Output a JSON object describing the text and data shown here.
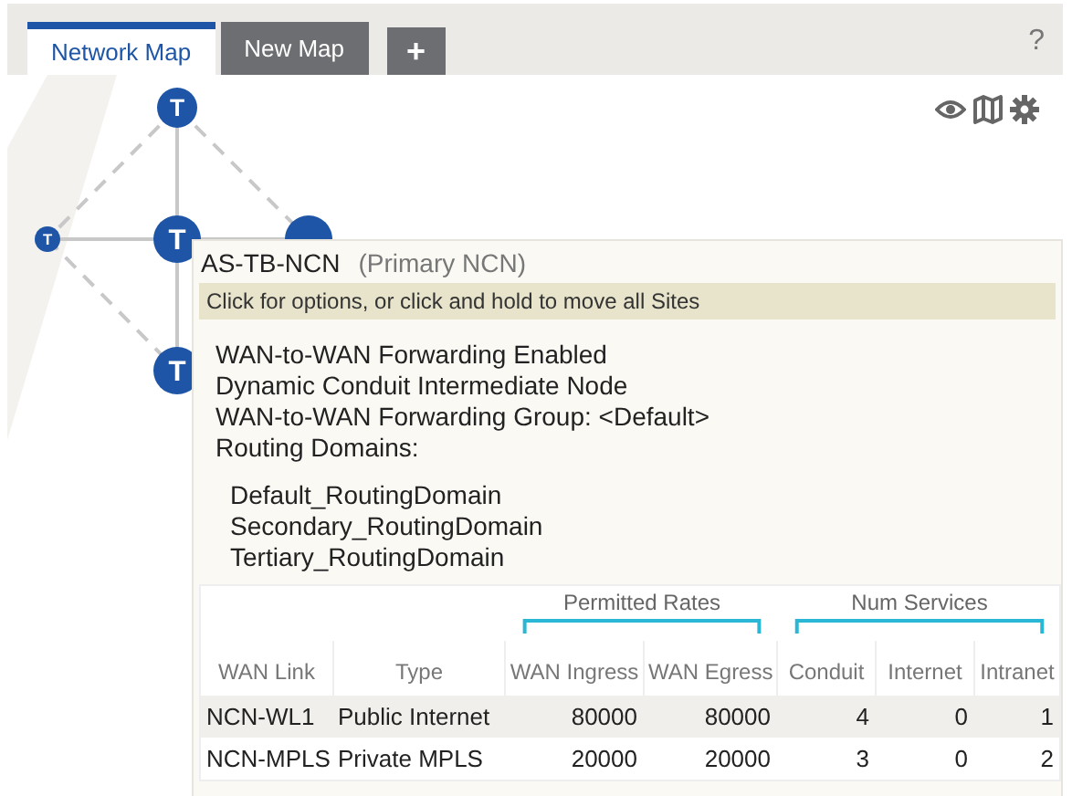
{
  "tabs": [
    {
      "label": "Network Map",
      "selected": true
    },
    {
      "label": "New Map",
      "selected": false
    }
  ],
  "add_tab": "+",
  "help": "?",
  "toolbar": [
    {
      "kind": "eye"
    },
    {
      "kind": "map"
    },
    {
      "kind": "gear"
    }
  ],
  "nodes": [
    {
      "label": "T"
    },
    {
      "label": "T"
    },
    {
      "label": "T"
    },
    {
      "label": "T"
    }
  ],
  "tooltip": {
    "site": "AS-TB-NCN",
    "role": "(Primary NCN)",
    "hint": "Click for options, or click and hold to move all Sites",
    "details": [
      "WAN-to-WAN Forwarding Enabled",
      "Dynamic Conduit Intermediate Node",
      "WAN-to-WAN Forwarding Group: <Default>",
      "Routing Domains:"
    ],
    "routing_domains": [
      "Default_RoutingDomain",
      "Secondary_RoutingDomain",
      "Tertiary_RoutingDomain"
    ],
    "table": {
      "groups": [
        {
          "label": "Permitted Rates"
        },
        {
          "label": "Num Services"
        }
      ],
      "columns": [
        "WAN Link",
        "Type",
        "WAN Ingress",
        "WAN Egress",
        "Conduit",
        "Internet",
        "Intranet"
      ],
      "rows": [
        {
          "selected": true,
          "cells": [
            "NCN-WL1",
            "Public Internet",
            "80000",
            "80000",
            "4",
            "0",
            "1"
          ]
        },
        {
          "selected": false,
          "cells": [
            "NCN-MPLS",
            "Private MPLS",
            "20000",
            "20000",
            "3",
            "0",
            "2"
          ]
        }
      ]
    }
  }
}
